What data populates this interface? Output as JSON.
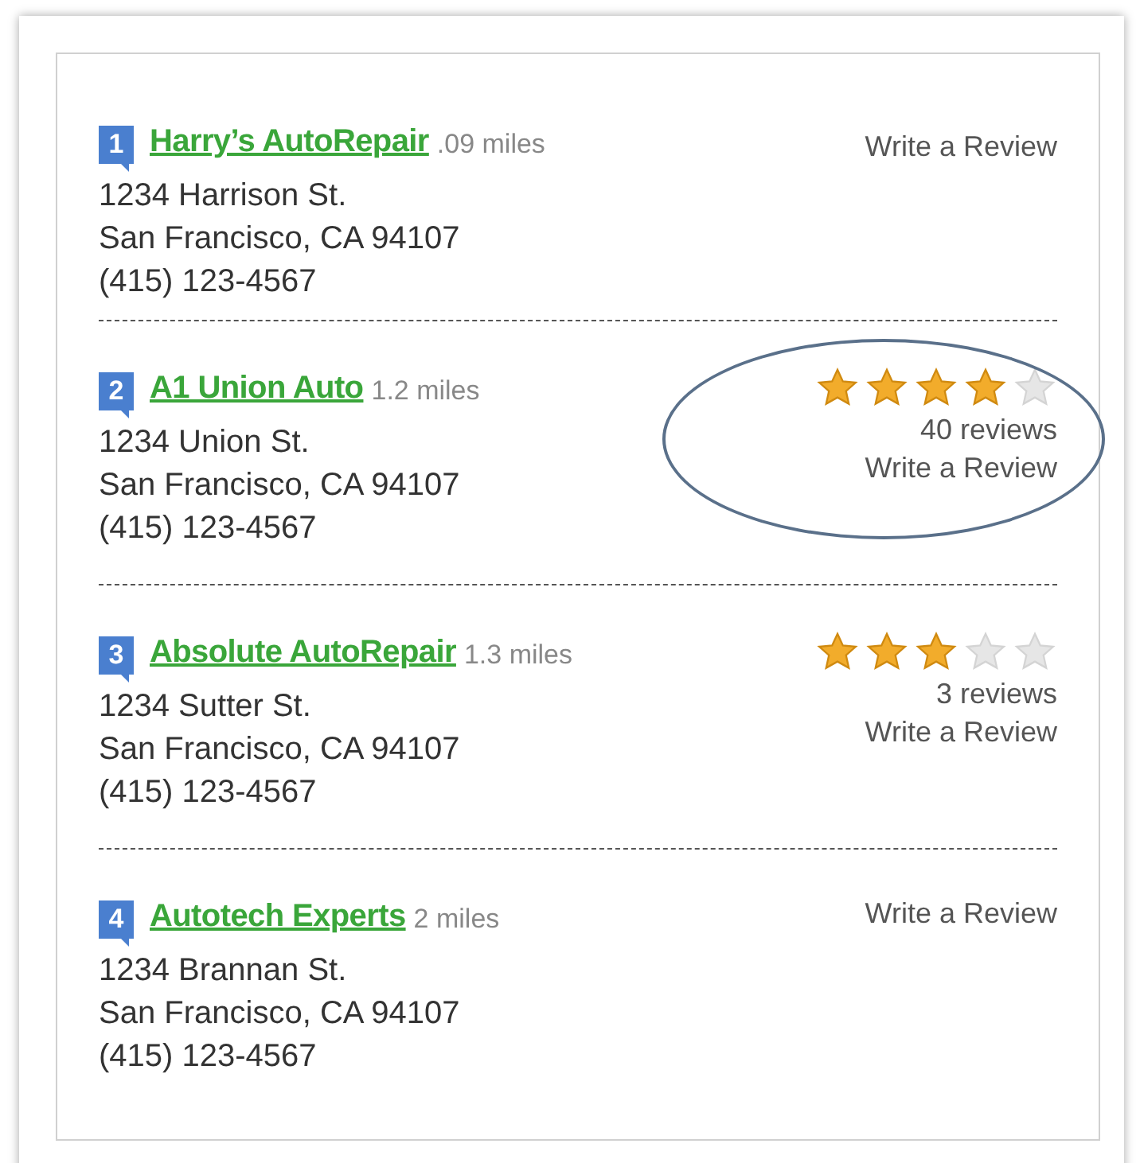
{
  "listings": [
    {
      "number": "1",
      "name": "Harry’s AutoRepair",
      "distance": ".09 miles",
      "street": "1234 Harrison St.",
      "city": "San Francisco, CA 94107",
      "phone": "(415) 123-4567",
      "review_link": "Write a Review",
      "circled": false
    },
    {
      "number": "2",
      "name": "A1 Union Auto",
      "distance": "1.2 miles",
      "street": "1234 Union St.",
      "city": "San Francisco, CA 94107",
      "phone": "(415) 123-4567",
      "stars": 4,
      "reviews": "40 reviews",
      "review_link": "Write a Review",
      "circled": true
    },
    {
      "number": "3",
      "name": "Absolute AutoRepair",
      "distance": "1.3 miles",
      "street": "1234 Sutter St.",
      "city": "San Francisco, CA 94107",
      "phone": "(415) 123-4567",
      "stars": 3,
      "reviews": "3 reviews",
      "review_link": "Write a Review",
      "circled": false
    },
    {
      "number": "4",
      "name": "Autotech Experts",
      "distance": "2 miles",
      "street": "1234 Brannan St.",
      "city": "San Francisco, CA 94107",
      "phone": "(415) 123-4567",
      "review_link": "Write a Review",
      "circled": false
    }
  ]
}
